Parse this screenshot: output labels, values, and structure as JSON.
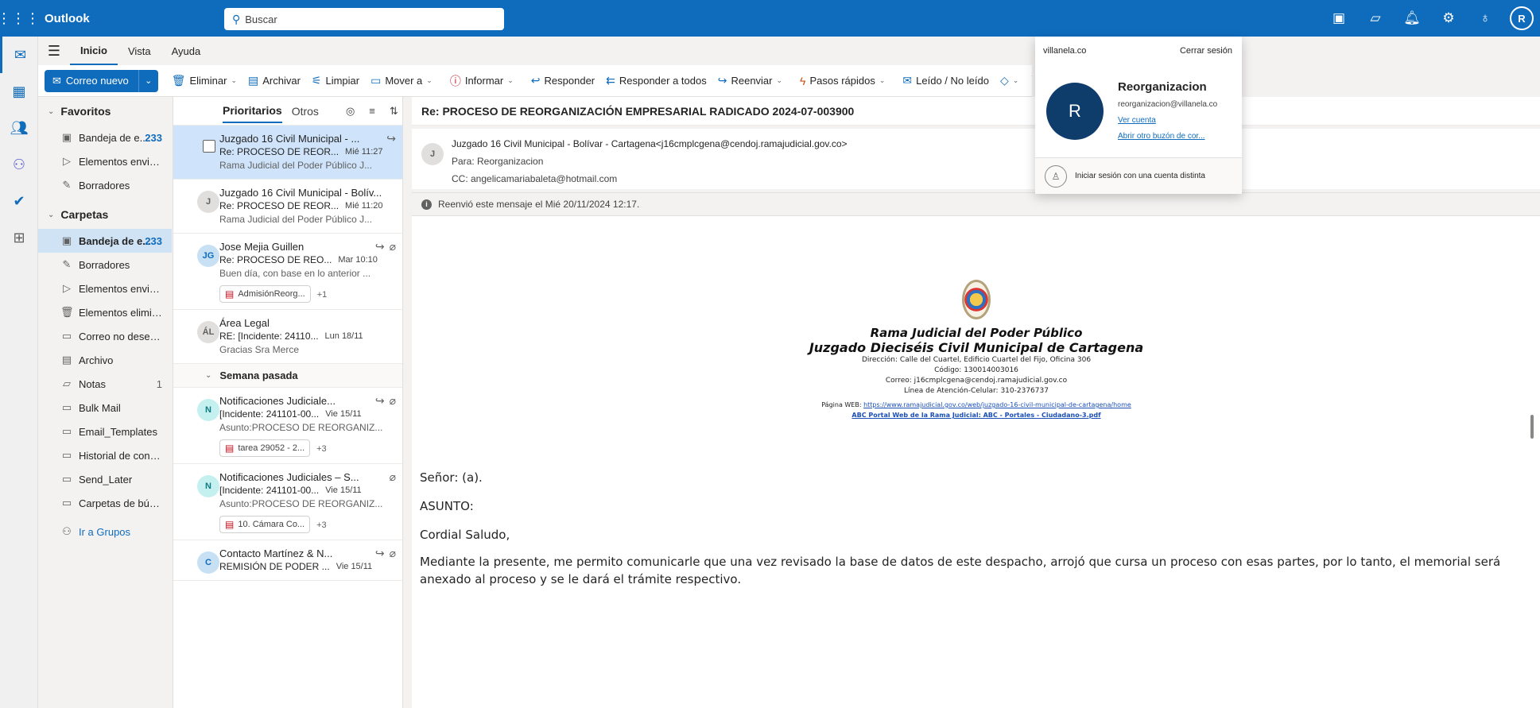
{
  "topbar": {
    "app_name": "Outlook",
    "search_placeholder": "Buscar",
    "avatar_initial": "R"
  },
  "menu_tabs": [
    "Inicio",
    "Vista",
    "Ayuda"
  ],
  "ribbon": {
    "new_mail": "Correo nuevo",
    "delete": "Eliminar",
    "archive": "Archivar",
    "sweep": "Limpiar",
    "move_to": "Mover a",
    "report": "Informar",
    "reply": "Responder",
    "reply_all": "Responder a todos",
    "forward": "Reenviar",
    "quick_steps": "Pasos rápidos",
    "read_unread": "Leído / No leído"
  },
  "folders": {
    "favorites_header": "Favoritos",
    "favorites": [
      {
        "label": "Bandeja de e...",
        "count": "233"
      },
      {
        "label": "Elementos enviados",
        "count": ""
      },
      {
        "label": "Borradores",
        "count": ""
      }
    ],
    "folders_header": "Carpetas",
    "items": [
      {
        "label": "Bandeja de e...",
        "count": "233"
      },
      {
        "label": "Borradores",
        "count": ""
      },
      {
        "label": "Elementos enviados",
        "count": ""
      },
      {
        "label": "Elementos elimina...",
        "count": ""
      },
      {
        "label": "Correo no deseado",
        "count": ""
      },
      {
        "label": "Archivo",
        "count": ""
      },
      {
        "label": "Notas",
        "count": "1"
      },
      {
        "label": "Bulk Mail",
        "count": ""
      },
      {
        "label": "Email_Templates",
        "count": ""
      },
      {
        "label": "Historial de conver...",
        "count": ""
      },
      {
        "label": "Send_Later",
        "count": ""
      },
      {
        "label": "Carpetas de búsqu...",
        "count": ""
      }
    ],
    "groups_link": "Ir a Grupos"
  },
  "message_list": {
    "tab_focused": "Prioritarios",
    "tab_other": "Otros",
    "week_header": "Semana pasada",
    "messages": [
      {
        "sender": "Juzgado 16 Civil Municipal - ...",
        "subject": "Re: PROCESO DE REOR...",
        "date": "Mié 11:27",
        "preview": "Rama Judicial del Poder Público J...",
        "initials": ""
      },
      {
        "sender": "Juzgado 16 Civil Municipal - Bolív...",
        "subject": "Re: PROCESO DE REOR...",
        "date": "Mié 11:20",
        "preview": "Rama Judicial del Poder Público J...",
        "initials": "J"
      },
      {
        "sender": "Jose Mejia Guillen",
        "subject": "Re: PROCESO DE REO...",
        "date": "Mar 10:10",
        "preview": "Buen día, con base en lo anterior ...",
        "initials": "JG",
        "attachment": "AdmisiónReorg...",
        "more": "+1"
      },
      {
        "sender": "Área Legal",
        "subject": "RE: [Incidente: 24110...",
        "date": "Lun 18/11",
        "preview": "Gracias Sra Merce",
        "initials": "ÁL"
      },
      {
        "sender": "Notificaciones Judiciale...",
        "subject": "[Incidente: 241101-00...",
        "date": "Vie 15/11",
        "preview": "Asunto:PROCESO DE REORGANIZ...",
        "initials": "N",
        "attachment": "tarea 29052 - 2...",
        "more": "+3"
      },
      {
        "sender": "Notificaciones Judiciales – S...",
        "subject": "[Incidente: 241101-00...",
        "date": "Vie 15/11",
        "preview": "Asunto:PROCESO DE REORGANIZ...",
        "initials": "N",
        "attachment": "10. Cámara Co...",
        "more": "+3"
      },
      {
        "sender": "Contacto Martínez & N...",
        "subject": "REMISIÓN DE PODER ...",
        "date": "Vie 15/11",
        "preview": "",
        "initials": "C"
      }
    ]
  },
  "reading": {
    "subject": "Re: PROCESO DE REORGANIZACIÓN EMPRESARIAL RADICADO 2024-07-003900",
    "sender_initial": "J",
    "from": "Juzgado 16 Civil Municipal - Bolívar - Cartagena<j16cmplcgena@cendoj.ramajudicial.gov.co>",
    "to": "Para:  Reorganizacion",
    "cc": "CC:  angelicamariabaleta@hotmail.com",
    "forwarded_note": "Reenvió este mensaje el Mié 20/11/2024 12:17.",
    "letterhead": {
      "title1": "Rama Judicial del Poder Público",
      "title2": "Juzgado Dieciséis Civil Municipal de Cartagena",
      "address": "Dirección: Calle del Cuartel, Edificio Cuartel del Fijo, Oficina 306",
      "code": "Código: 130014003016",
      "email": "Correo: j16cmplcgena@cendoj.ramajudicial.gov.co",
      "phone": "Línea de Atención-Celular:  310-2376737",
      "web_label": "Página WEB: ",
      "web_url": "https://www.ramajudicial.gov.co/web/juzgado-16-civil-municipal-de-cartagena/home",
      "abc": "ABC Portal Web de la Rama Judicial: ABC - Portales - Ciudadano-3.pdf"
    },
    "body": {
      "greeting": "Señor: (a).",
      "asunto": "ASUNTO:",
      "cordial": "Cordial Saludo,",
      "paragraph": "Mediante la presente,  me permito comunicarle que una vez revisado la base de datos de este despacho, arrojó que cursa un proceso con esas partes, por lo tanto, el memorial será anexado al proceso y se le dará el trámite respectivo."
    }
  },
  "account_popup": {
    "domain": "villanela.co",
    "sign_out": "Cerrar sesión",
    "avatar_initial": "R",
    "name": "Reorganizacion",
    "email": "reorganizacion@villanela.co",
    "view_account": "Ver cuenta",
    "open_other": "Abrir otro buzón de cor...",
    "other_account": "Iniciar sesión con una cuenta distinta"
  },
  "colors": {
    "brand": "#0f6cbd",
    "selected": "#cfe4fa",
    "unread_count": "#0f6cbd"
  }
}
